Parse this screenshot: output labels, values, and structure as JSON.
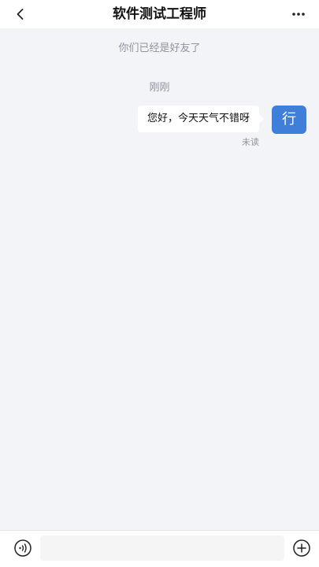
{
  "header": {
    "title": "软件测试工程师"
  },
  "chat": {
    "system_message": "你们已经是好友了",
    "timestamp": "刚刚",
    "messages": [
      {
        "text": "您好，今天天气不错呀",
        "status": "未读",
        "avatar_text": "行",
        "avatar_color": "#3f7fd9"
      }
    ]
  },
  "input": {
    "placeholder": ""
  }
}
